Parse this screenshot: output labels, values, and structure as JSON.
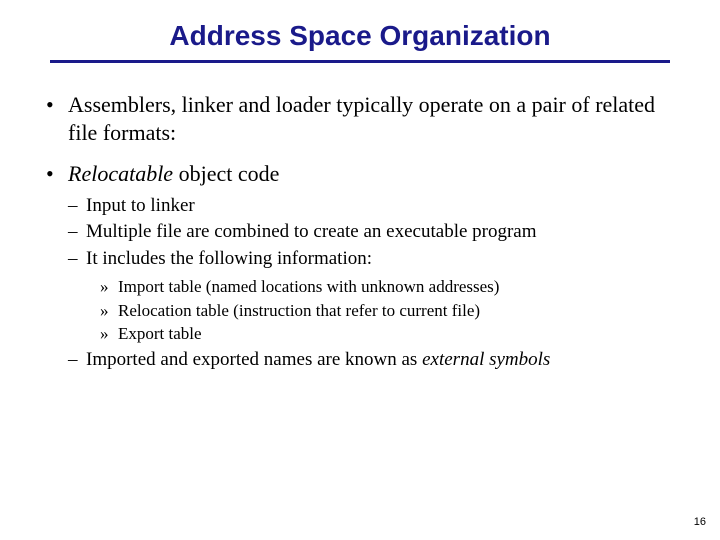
{
  "title": "Address Space Organization",
  "bullets": {
    "b1": "Assemblers, linker and loader typically operate on a pair of related file formats:",
    "b2_prefix": "Relocatable",
    "b2_rest": " object code",
    "sub": {
      "s1": "Input to linker",
      "s2": "Multiple file are combined to create an executable program",
      "s3": "It includes the following information:",
      "s3_items": {
        "i1": "Import table (named locations with unknown addresses)",
        "i2": "Relocation table (instruction that refer to current file)",
        "i3": "Export table"
      },
      "s4_pre": "Imported and exported names are known as ",
      "s4_em": "external symbols"
    }
  },
  "page_number": "16"
}
